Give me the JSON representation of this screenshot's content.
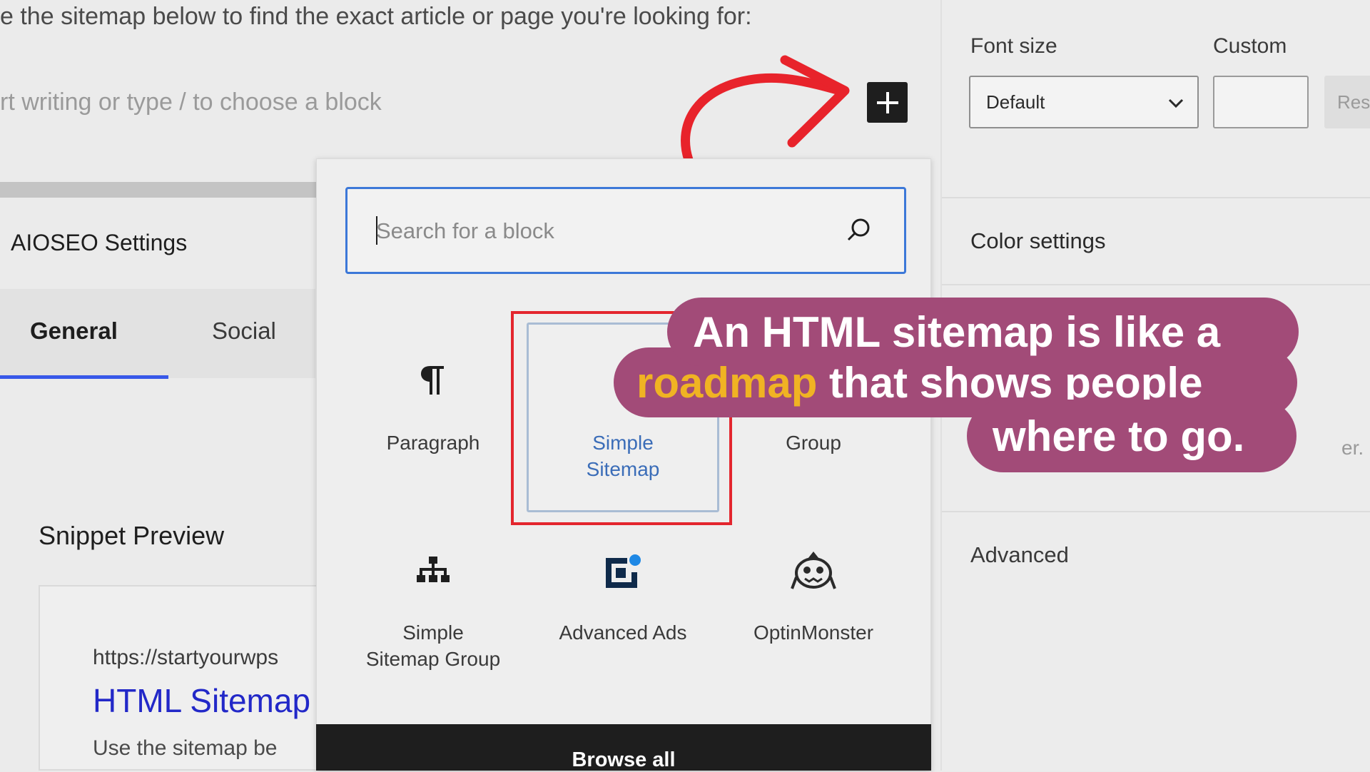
{
  "editor": {
    "intro_text": "e the sitemap below to find the exact article or page you're looking for:",
    "placeholder": "rt writing or type / to choose a block"
  },
  "aioseo": {
    "title": "AIOSEO Settings",
    "tabs": [
      {
        "label": "General",
        "active": true
      },
      {
        "label": "Social",
        "active": false
      }
    ],
    "snippet_title": "Snippet Preview",
    "snippet_url": "https://startyourwps",
    "snippet_link": "HTML Sitemap",
    "snippet_desc": "Use the sitemap be"
  },
  "sidebar": {
    "font_size_label": "Font size",
    "custom_label": "Custom",
    "font_size_value": "Default",
    "custom_value": "",
    "reset_label": "Res",
    "color_settings_label": "Color settings",
    "partial_text": "er.",
    "advanced_label": "Advanced"
  },
  "inserter": {
    "search_placeholder": "Search for a block",
    "blocks": [
      {
        "label": "Paragraph",
        "icon": "paragraph-icon"
      },
      {
        "label_line1": "Simple",
        "label_line2": "Sitemap",
        "icon": "sitemap-icon",
        "selected": true
      },
      {
        "label": "Group",
        "icon": "group-icon"
      },
      {
        "label_line1": "Simple",
        "label_line2": "Sitemap Group",
        "icon": "sitemap-group-icon"
      },
      {
        "label": "Advanced Ads",
        "icon": "advanced-ads-icon"
      },
      {
        "label": "OptinMonster",
        "icon": "optinmonster-icon"
      }
    ],
    "browse_all": "Browse all"
  },
  "caption": {
    "line1": "An HTML sitemap is like a",
    "line2_highlight": "roadmap",
    "line2_rest": " that shows people",
    "line3": "where to go."
  },
  "colors": {
    "accent_blue": "#3858e9",
    "caption_bg": "#a24b78",
    "caption_highlight": "#f0b323",
    "highlight_red": "#e3262e",
    "arrow_red": "#e8232b"
  }
}
